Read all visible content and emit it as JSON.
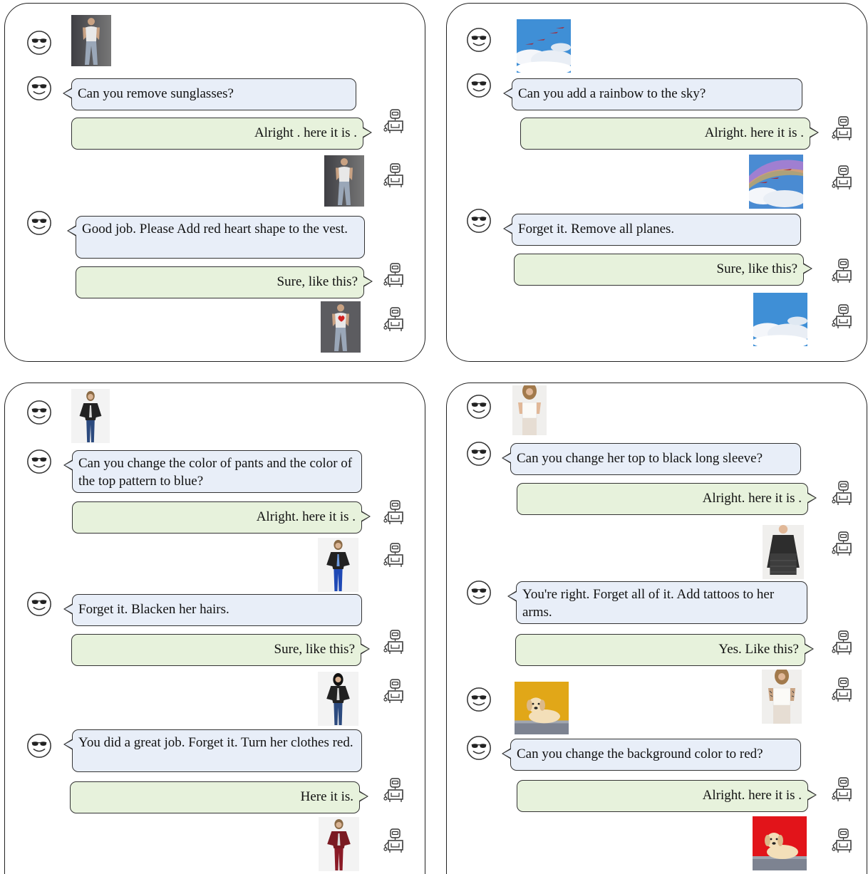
{
  "panels": [
    {
      "messages": [
        {
          "role": "user",
          "text": "Can you remove sunglasses?"
        },
        {
          "role": "bot",
          "text": "Alright . here it is ."
        },
        {
          "role": "user",
          "text": "Good job. Please Add red heart shape to the vest."
        },
        {
          "role": "bot",
          "text": "Sure, like this?"
        }
      ]
    },
    {
      "messages": [
        {
          "role": "user",
          "text": "Can you add a rainbow to the sky?"
        },
        {
          "role": "bot",
          "text": "Alright. here it is ."
        },
        {
          "role": "user",
          "text": "Forget it. Remove all planes."
        },
        {
          "role": "bot",
          "text": "Sure, like this?"
        }
      ]
    },
    {
      "messages": [
        {
          "role": "user",
          "text": "Can you change the color of pants and the color of the top pattern to blue?"
        },
        {
          "role": "bot",
          "text": "Alright. here it is ."
        },
        {
          "role": "user",
          "text": "Forget it. Blacken her hairs."
        },
        {
          "role": "bot",
          "text": "Sure, like this?"
        },
        {
          "role": "user",
          "text": "You did a great job. Forget it. Turn her clothes red."
        },
        {
          "role": "bot",
          "text": "Here it is."
        }
      ]
    },
    {
      "messages": [
        {
          "role": "user",
          "text": "Can you change her top to black long sleeve?"
        },
        {
          "role": "bot",
          "text": "Alright. here it is ."
        },
        {
          "role": "user",
          "text": "You're right. Forget all of it. Add tattoos to her arms."
        },
        {
          "role": "bot",
          "text": "Yes. Like this?"
        },
        {
          "role": "user",
          "text": "Can you change the background color to red?"
        },
        {
          "role": "bot",
          "text": "Alright. here it is ."
        }
      ]
    }
  ],
  "icons": {
    "user": "smiley-sunglasses-icon",
    "bot": "robot-icon"
  },
  "colors": {
    "user_bubble": "#e8eef8",
    "bot_bubble": "#e7f2dc"
  }
}
